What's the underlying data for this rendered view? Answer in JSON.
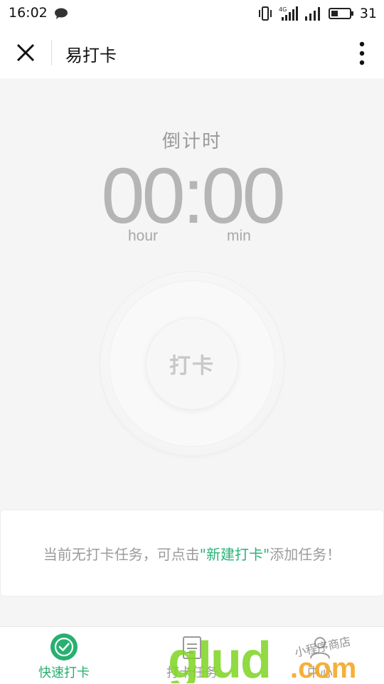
{
  "status_bar": {
    "time": "16:02",
    "battery": "31"
  },
  "nav": {
    "title": "易打卡"
  },
  "countdown": {
    "label": "倒计时",
    "time": "00:00",
    "hour_unit": "hour",
    "min_unit": "min"
  },
  "punch_button": {
    "label": "打卡"
  },
  "notice": {
    "prefix": "当前无打卡任务，可点击",
    "link": "\"新建打卡\"",
    "suffix": "添加任务！"
  },
  "tabs": [
    {
      "label": "快速打卡",
      "icon": "check-circle-icon",
      "active": true
    },
    {
      "label": "打卡任务",
      "icon": "task-list-icon",
      "active": false
    },
    {
      "label": "中心",
      "icon": "user-icon",
      "active": false
    }
  ],
  "watermark": {
    "text": ".com",
    "brand": "glud",
    "tagline": "小程序商店"
  },
  "colors": {
    "accent": "#27b06f",
    "link": "#29b37a"
  }
}
